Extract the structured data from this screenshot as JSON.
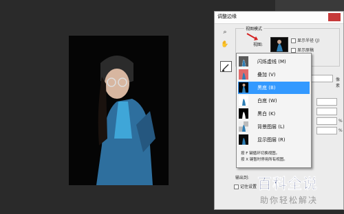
{
  "dialog": {
    "title": "调整边缘",
    "view_group": {
      "legend": "视图模式",
      "view_label": "视图:"
    },
    "show_radius": "显示半径 (J)",
    "show_original": "显示原稿"
  },
  "view_modes": [
    {
      "label": "闪烁虚线 (M)",
      "selected": false,
      "thumb": "marching-ants"
    },
    {
      "label": "叠加 (V)",
      "selected": false,
      "thumb": "overlay"
    },
    {
      "label": "黑底 (B)",
      "selected": true,
      "thumb": "on-black"
    },
    {
      "label": "白底 (W)",
      "selected": false,
      "thumb": "on-white"
    },
    {
      "label": "黑白 (K)",
      "selected": false,
      "thumb": "black-white"
    },
    {
      "label": "背景图层 (L)",
      "selected": false,
      "thumb": "on-layers"
    },
    {
      "label": "显示图层 (R)",
      "selected": false,
      "thumb": "reveal-layer"
    }
  ],
  "notes": {
    "line1": "按 F 键循环切换视图。",
    "line2": "按 X 键暂时停用所有视图。"
  },
  "partial": {
    "pixel_label": "像素",
    "pct1": "%",
    "pct2": "%",
    "output_label": "输出到:"
  },
  "remember_label": "记住设置",
  "watermark": {
    "title": "百科全说",
    "subtitle": "助你轻松解决"
  },
  "colors": {
    "selection": "#3399ff",
    "window_bg": "#2a2a2a",
    "dialog_bg": "#ececec"
  }
}
